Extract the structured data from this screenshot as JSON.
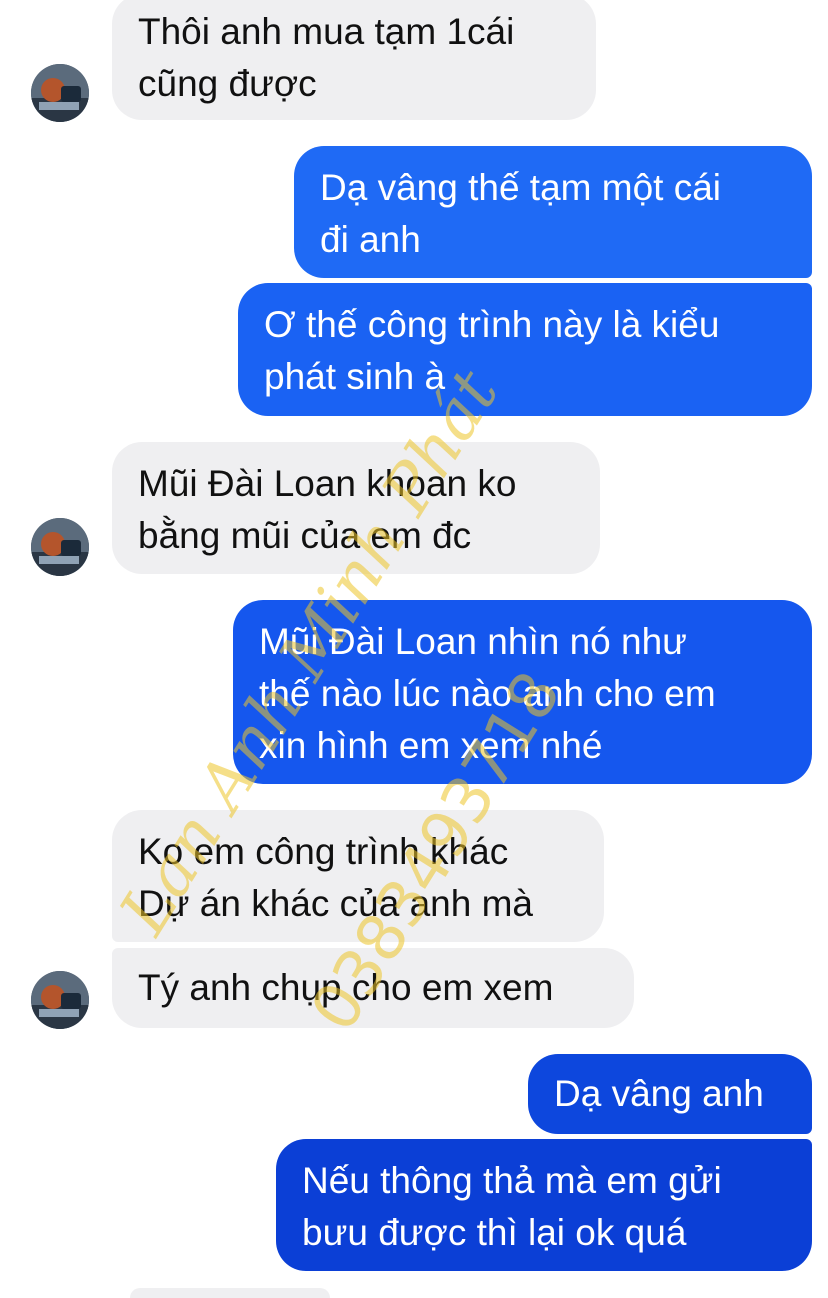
{
  "colors": {
    "incoming_bubble": "#efeff1",
    "outgoing_top": "#1f6af5",
    "outgoing_mid": "#1557ee",
    "outgoing_bottom": "#0b3fd6",
    "watermark": "#ecc428"
  },
  "messages": [
    {
      "side": "in",
      "text": "Thôi anh mua tạm 1cái\ncũng được"
    },
    {
      "side": "out",
      "text": "Dạ vâng thế tạm một cái\nđi anh"
    },
    {
      "side": "out",
      "text": "Ơ thế công trình này là kiểu\nphát sinh à"
    },
    {
      "side": "in",
      "text": "Mũi Đài Loan khoan ko\nbằng mũi của em đc"
    },
    {
      "side": "out",
      "text": "Mũi Đài Loan nhìn nó như\nthế nào lúc nào anh cho em\nxin hình em xem nhé"
    },
    {
      "side": "in",
      "text": "Ko em công trình khác\nDự án khác của anh mà"
    },
    {
      "side": "in",
      "text": "Tý anh chụp cho em xem"
    },
    {
      "side": "out",
      "text": "Dạ vâng anh"
    },
    {
      "side": "out",
      "text": "Nếu thông thả mà em gửi\nbưu được thì lại ok quá"
    }
  ],
  "watermark": {
    "name": "Lan Anh Minh Phát",
    "phone": "0383493718"
  },
  "avatar_icon": "contact-avatar-icon"
}
